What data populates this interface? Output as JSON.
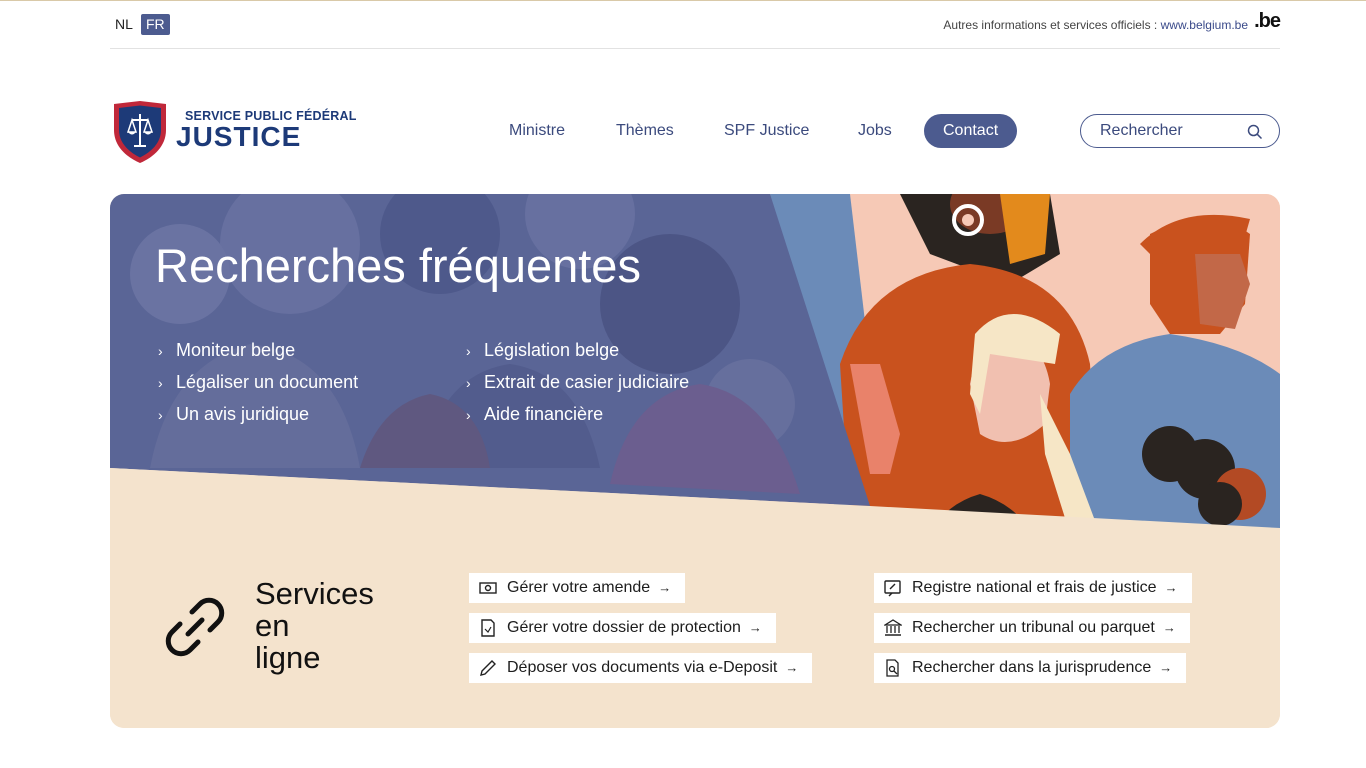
{
  "top_bar": {
    "languages": [
      "NL",
      "FR"
    ],
    "active_language": "FR",
    "official_text": "Autres informations et services officiels :",
    "official_link": "www.belgium.be",
    "be_logo": ".be"
  },
  "header": {
    "logo_line1": "SERVICE PUBLIC FÉDÉRAL",
    "logo_line2": "JUSTICE",
    "nav": [
      "Ministre",
      "Thèmes",
      "SPF Justice",
      "Jobs",
      "Contact"
    ],
    "search_placeholder": "Rechercher"
  },
  "hero": {
    "title": "Recherches fréquentes",
    "links_left": [
      "Moniteur belge",
      "Légaliser un document",
      "Un avis juridique"
    ],
    "links_right": [
      "Législation belge",
      "Extrait de casier judiciaire",
      "Aide financière"
    ]
  },
  "services": {
    "title": "Services en ligne",
    "title_lines": [
      "Services",
      "en",
      "ligne"
    ],
    "items_left": [
      {
        "label": "Gérer votre amende",
        "icon": "money-icon"
      },
      {
        "label": "Gérer votre dossier de protection",
        "icon": "document-icon"
      },
      {
        "label": "Déposer vos documents via e-Deposit",
        "icon": "pencil-icon"
      }
    ],
    "items_right": [
      {
        "label": "Registre national et frais de justice",
        "icon": "edit-register-icon"
      },
      {
        "label": "Rechercher un tribunal ou parquet",
        "icon": "courthouse-icon"
      },
      {
        "label": "Rechercher dans la jurisprudence",
        "icon": "search-document-icon"
      }
    ]
  },
  "colors": {
    "brand_blue": "#1d3a78",
    "accent": "#4c5b8f",
    "hero_overlay": "#5a6596",
    "beige": "#f4e3cd",
    "shield_red": "#c0283a"
  }
}
